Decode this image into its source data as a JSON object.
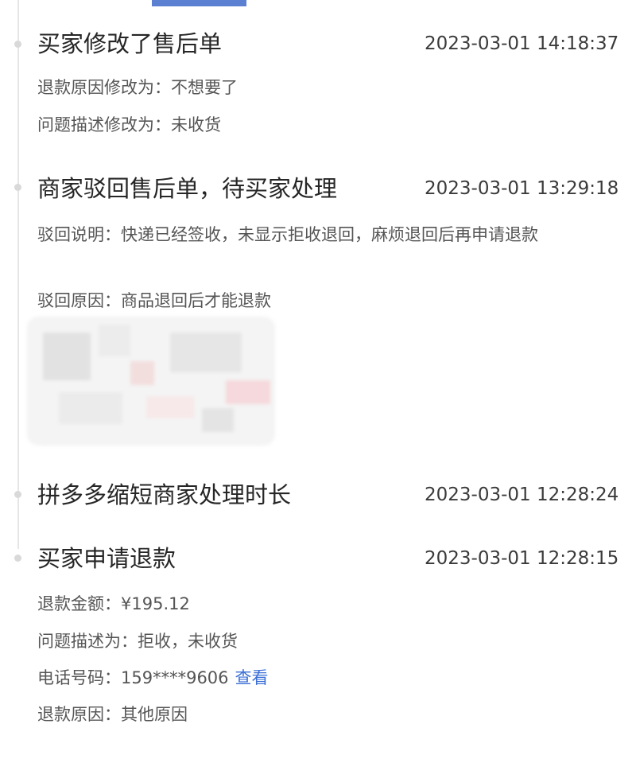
{
  "events": [
    {
      "title": "买家修改了售后单",
      "time": "2023-03-01 14:18:37",
      "details": [
        {
          "label": "退款原因修改为：",
          "value": "不想要了"
        },
        {
          "label": "问题描述修改为：",
          "value": "未收货"
        }
      ]
    },
    {
      "title": "商家驳回售后单，待买家处理",
      "time": "2023-03-01 13:29:18",
      "details": [
        {
          "label": "驳回说明：",
          "value": "快递已经签收，未显示拒收退回，麻烦退回后再申请退款"
        },
        {
          "label": "驳回原因：",
          "value": "商品退回后才能退款"
        }
      ]
    },
    {
      "title": "拼多多缩短商家处理时长",
      "time": "2023-03-01 12:28:24"
    },
    {
      "title": "买家申请退款",
      "time": "2023-03-01 12:28:15",
      "details": [
        {
          "label": "退款金额：",
          "value": "¥195.12"
        },
        {
          "label": "问题描述为：",
          "value": "拒收，未收货"
        },
        {
          "label": "电话号码：",
          "value": "159****9606",
          "link": "查看"
        },
        {
          "label": "退款原因：",
          "value": "其他原因"
        }
      ]
    }
  ],
  "colors": {
    "accent": "#5b7fd1",
    "link": "#3b6fd6",
    "timeline": "#e6e6e6"
  }
}
